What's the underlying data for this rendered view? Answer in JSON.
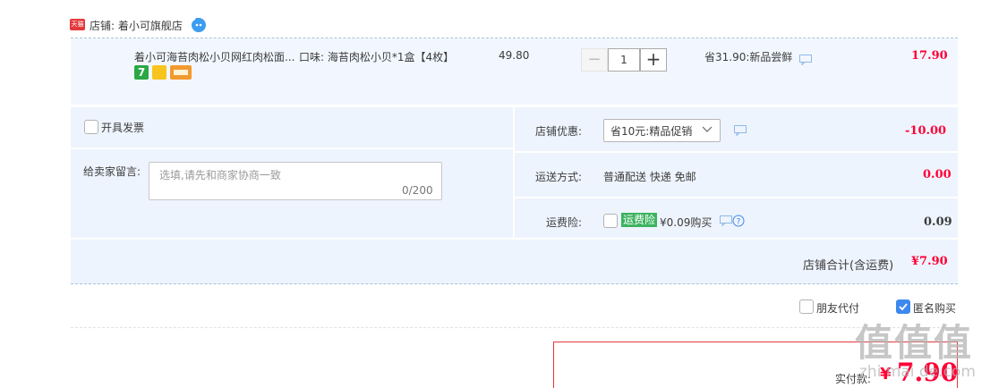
{
  "shop": {
    "tmall_badge": "天猫",
    "label": "店铺: 着小可旗舰店"
  },
  "item": {
    "title": "着小可海苔肉松小贝网红肉松面...",
    "sku": "口味: 海苔肉松小贝*1盒【4枚】",
    "unit_price": "49.80",
    "qty_minus": "−",
    "quantity": "1",
    "qty_plus": "+",
    "promo": "省31.90:新品尝鲜",
    "subtotal": "17.90"
  },
  "invoice": {
    "label": "开具发票"
  },
  "message": {
    "label": "给卖家留言:",
    "placeholder": "选填,请先和商家协商一致",
    "count": "0/200"
  },
  "discount": {
    "label": "店铺优惠:",
    "selected": "省10元:精品促销",
    "value": "-10.00"
  },
  "shipping": {
    "label": "运送方式:",
    "method": "普通配送 快递 免邮",
    "value": "0.00"
  },
  "insurance": {
    "label": "运费险:",
    "tag": "运费险",
    "price": "¥0.09购买",
    "value": "0.09"
  },
  "store_total": {
    "label": "店铺合计(含运费)",
    "value": "¥7.90"
  },
  "options": {
    "friend_pay": "朋友代付",
    "anonymous": "匿名购买"
  },
  "payment": {
    "label": "实付款:",
    "currency": "¥",
    "amount": "7.90"
  },
  "watermark": {
    "text": "值值值",
    "sub": "zhi mai de.com"
  },
  "colors": {
    "accent_red": "#ff0036",
    "panel_bg": "#eef4fd",
    "checkbox_blue": "#3d88ee",
    "insurance_green": "#3cb35f"
  }
}
